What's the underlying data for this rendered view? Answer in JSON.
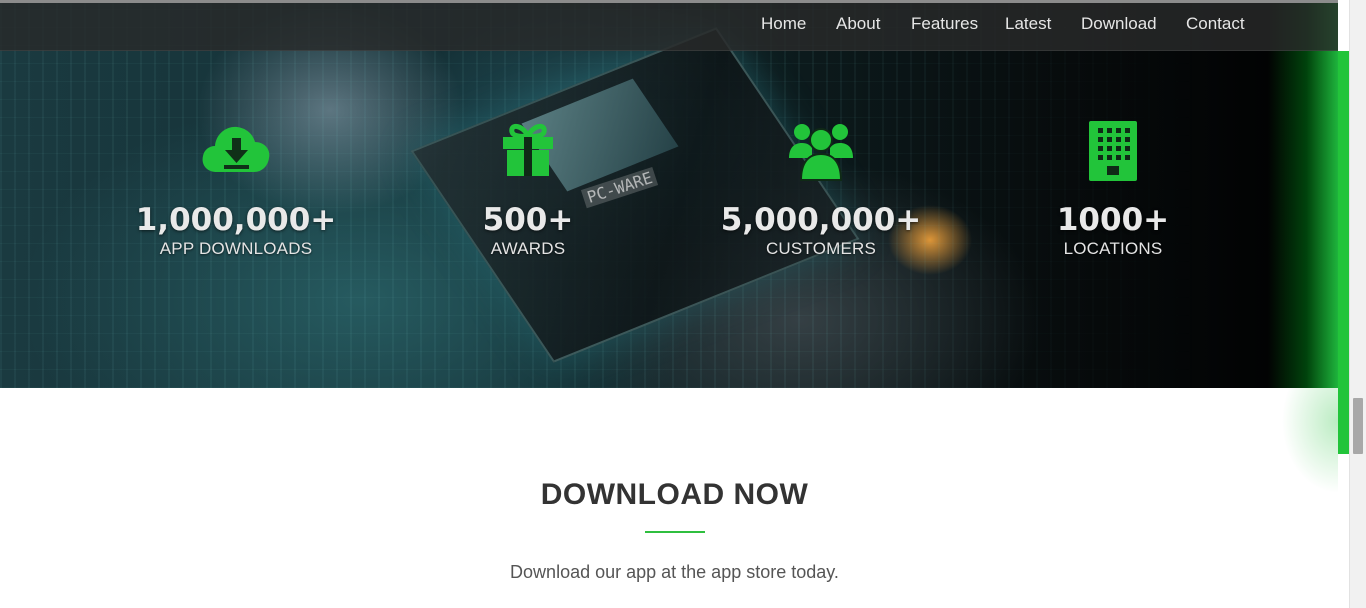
{
  "nav": {
    "items": [
      {
        "label": "Home"
      },
      {
        "label": "About"
      },
      {
        "label": "Features"
      },
      {
        "label": "Latest"
      },
      {
        "label": "Download"
      },
      {
        "label": "Contact"
      }
    ]
  },
  "hero": {
    "chip_label": "PC-WARE"
  },
  "stats": [
    {
      "icon": "cloud-download-icon",
      "value": "1,000,000+",
      "label": "APP DOWNLOADS"
    },
    {
      "icon": "gift-icon",
      "value": "500+",
      "label": "AWARDS"
    },
    {
      "icon": "users-icon",
      "value": "5,000,000+",
      "label": "CUSTOMERS"
    },
    {
      "icon": "building-icon",
      "value": "1000+",
      "label": "LOCATIONS"
    }
  ],
  "download": {
    "title": "DOWNLOAD NOW",
    "subtitle": "Download our app at the app store today."
  },
  "colors": {
    "accent": "#22c43a",
    "nav_bg": "#282a2a",
    "text_light": "#e6e6e6",
    "heading": "#333333"
  }
}
